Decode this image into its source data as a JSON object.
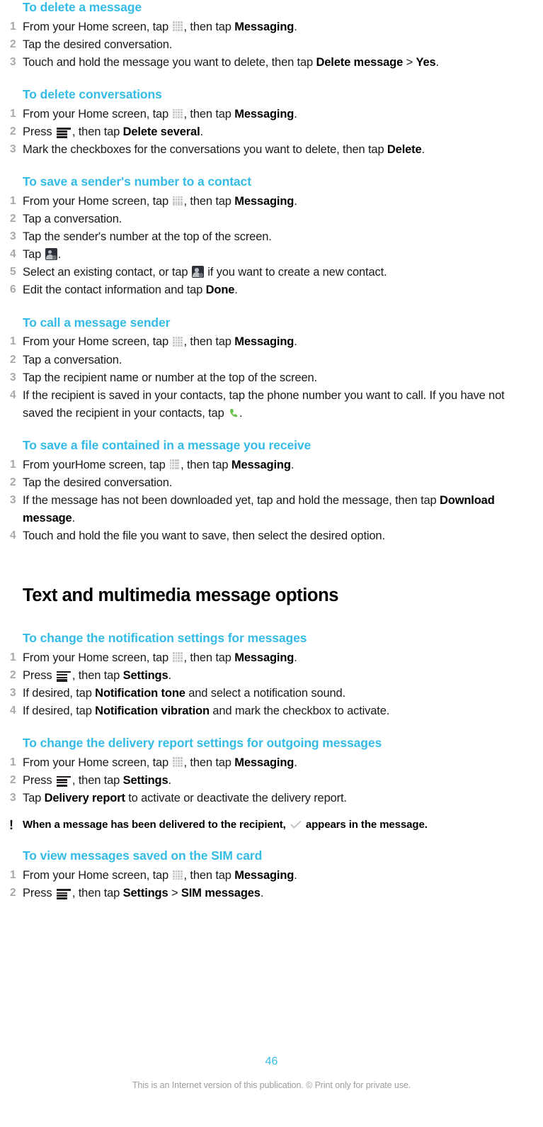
{
  "page": {
    "number": "46",
    "disclaimer": "This is an Internet version of this publication. © Print only for private use."
  },
  "icons": {
    "apps": "apps-grid-icon",
    "menu": "menu-icon",
    "contact": "add-contact-icon",
    "phone": "green-phone-icon",
    "check": "delivered-check-icon",
    "bang": "!"
  },
  "colors": {
    "heading": "#34bbe6",
    "body": "#1a1a1a",
    "number": "#a8a8a8",
    "page_number": "#34bbe6",
    "disclaimer": "#9d9d9d",
    "phone_icon": "#6cc24a",
    "menu_icon": "#231f20",
    "apps_icon": "#c9c9c9"
  },
  "sections": [
    {
      "id": "delete-a-message",
      "heading": "To delete a message",
      "steps": [
        {
          "n": "1",
          "parts": [
            {
              "t": "From your Home screen, tap "
            },
            {
              "icon": "apps"
            },
            {
              "t": ", then tap "
            },
            {
              "b": "Messaging"
            },
            {
              "t": "."
            }
          ]
        },
        {
          "n": "2",
          "parts": [
            {
              "t": "Tap the desired conversation."
            }
          ]
        },
        {
          "n": "3",
          "parts": [
            {
              "t": "Touch and hold the message you want to delete, then tap "
            },
            {
              "b": "Delete message"
            },
            {
              "t": " > "
            },
            {
              "b": "Yes"
            },
            {
              "t": "."
            }
          ]
        }
      ]
    },
    {
      "id": "delete-conversations",
      "heading": "To delete conversations",
      "steps": [
        {
          "n": "1",
          "parts": [
            {
              "t": "From your Home screen, tap "
            },
            {
              "icon": "apps"
            },
            {
              "t": ", then tap "
            },
            {
              "b": "Messaging"
            },
            {
              "t": "."
            }
          ]
        },
        {
          "n": "2",
          "parts": [
            {
              "t": "Press "
            },
            {
              "icon": "menu"
            },
            {
              "t": ", then tap "
            },
            {
              "b": "Delete several"
            },
            {
              "t": "."
            }
          ]
        },
        {
          "n": "3",
          "parts": [
            {
              "t": "Mark the checkboxes for the conversations you want to delete, then tap "
            },
            {
              "b": "Delete"
            },
            {
              "t": "."
            }
          ]
        }
      ]
    },
    {
      "id": "save-senders-number",
      "heading": "To save a sender's number to a contact",
      "steps": [
        {
          "n": "1",
          "parts": [
            {
              "t": "From your Home screen, tap "
            },
            {
              "icon": "apps"
            },
            {
              "t": ", then tap "
            },
            {
              "b": "Messaging"
            },
            {
              "t": "."
            }
          ]
        },
        {
          "n": "2",
          "parts": [
            {
              "t": "Tap a conversation."
            }
          ]
        },
        {
          "n": "3",
          "parts": [
            {
              "t": "Tap the sender's number at the top of the screen."
            }
          ]
        },
        {
          "n": "4",
          "parts": [
            {
              "t": "Tap "
            },
            {
              "icon": "contact"
            },
            {
              "t": "."
            }
          ]
        },
        {
          "n": "5",
          "parts": [
            {
              "t": "Select an existing contact, or tap "
            },
            {
              "icon": "contact"
            },
            {
              "t": " if you want to create a new contact."
            }
          ]
        },
        {
          "n": "6",
          "parts": [
            {
              "t": "Edit the contact information and tap "
            },
            {
              "b": "Done"
            },
            {
              "t": "."
            }
          ]
        }
      ]
    },
    {
      "id": "call-a-message-sender",
      "heading": "To call a message sender",
      "steps": [
        {
          "n": "1",
          "parts": [
            {
              "t": "From your Home screen, tap "
            },
            {
              "icon": "apps"
            },
            {
              "t": ", then tap "
            },
            {
              "b": "Messaging"
            },
            {
              "t": "."
            }
          ]
        },
        {
          "n": "2",
          "parts": [
            {
              "t": "Tap a conversation."
            }
          ]
        },
        {
          "n": "3",
          "parts": [
            {
              "t": "Tap the recipient name or number at the top of the screen."
            }
          ]
        },
        {
          "n": "4",
          "parts": [
            {
              "t": "If the recipient is saved in your contacts, tap the phone number you want to call. If you have not saved the recipient in your contacts, tap "
            },
            {
              "icon": "phone"
            },
            {
              "t": "."
            }
          ]
        }
      ]
    },
    {
      "id": "save-a-file",
      "heading": "To save a file contained in a message you receive",
      "steps": [
        {
          "n": "1",
          "parts": [
            {
              "t": "From yourHome screen, tap "
            },
            {
              "icon": "apps"
            },
            {
              "t": ", then tap "
            },
            {
              "b": "Messaging"
            },
            {
              "t": "."
            }
          ]
        },
        {
          "n": "2",
          "parts": [
            {
              "t": "Tap the desired conversation."
            }
          ]
        },
        {
          "n": "3",
          "parts": [
            {
              "t": "If the message has not been downloaded yet, tap and hold the message, then tap "
            },
            {
              "b": "Download message"
            },
            {
              "t": "."
            }
          ]
        },
        {
          "n": "4",
          "parts": [
            {
              "t": "Touch and hold the file you want to save, then select the desired option."
            }
          ]
        }
      ]
    }
  ],
  "main_heading": "Text and multimedia message options",
  "sections2": [
    {
      "id": "notification-settings",
      "heading": "To change the notification settings for messages",
      "steps": [
        {
          "n": "1",
          "parts": [
            {
              "t": "From your Home screen, tap "
            },
            {
              "icon": "apps"
            },
            {
              "t": ", then tap "
            },
            {
              "b": "Messaging"
            },
            {
              "t": "."
            }
          ]
        },
        {
          "n": "2",
          "parts": [
            {
              "t": "Press "
            },
            {
              "icon": "menu"
            },
            {
              "t": ", then tap "
            },
            {
              "b": "Settings"
            },
            {
              "t": "."
            }
          ]
        },
        {
          "n": "3",
          "parts": [
            {
              "t": "If desired, tap "
            },
            {
              "b": "Notification tone"
            },
            {
              "t": " and select a notification sound."
            }
          ]
        },
        {
          "n": "4",
          "parts": [
            {
              "t": "If desired, tap "
            },
            {
              "b": "Notification vibration"
            },
            {
              "t": " and mark the checkbox to activate."
            }
          ]
        }
      ]
    },
    {
      "id": "delivery-report-settings",
      "heading": "To change the delivery report settings for outgoing messages",
      "steps": [
        {
          "n": "1",
          "parts": [
            {
              "t": "From your Home screen, tap "
            },
            {
              "icon": "apps"
            },
            {
              "t": ", then tap "
            },
            {
              "b": "Messaging"
            },
            {
              "t": "."
            }
          ]
        },
        {
          "n": "2",
          "parts": [
            {
              "t": "Press "
            },
            {
              "icon": "menu"
            },
            {
              "t": ", then tap "
            },
            {
              "b": "Settings"
            },
            {
              "t": "."
            }
          ]
        },
        {
          "n": "3",
          "parts": [
            {
              "t": "Tap "
            },
            {
              "b": "Delivery report"
            },
            {
              "t": " to activate or deactivate the delivery report."
            }
          ]
        }
      ],
      "note": {
        "parts": [
          {
            "t": "When a message has been delivered to the recipient, "
          },
          {
            "icon": "check"
          },
          {
            "t": " appears in the message."
          }
        ]
      }
    },
    {
      "id": "view-sim-messages",
      "heading": "To view messages saved on the SIM card",
      "steps": [
        {
          "n": "1",
          "parts": [
            {
              "t": "From your Home screen, tap "
            },
            {
              "icon": "apps"
            },
            {
              "t": ", then tap "
            },
            {
              "b": "Messaging"
            },
            {
              "t": "."
            }
          ]
        },
        {
          "n": "2",
          "parts": [
            {
              "t": "Press "
            },
            {
              "icon": "menu"
            },
            {
              "t": ", then tap "
            },
            {
              "b": "Settings"
            },
            {
              "t": " > "
            },
            {
              "b": "SIM messages"
            },
            {
              "t": "."
            }
          ]
        }
      ]
    }
  ]
}
